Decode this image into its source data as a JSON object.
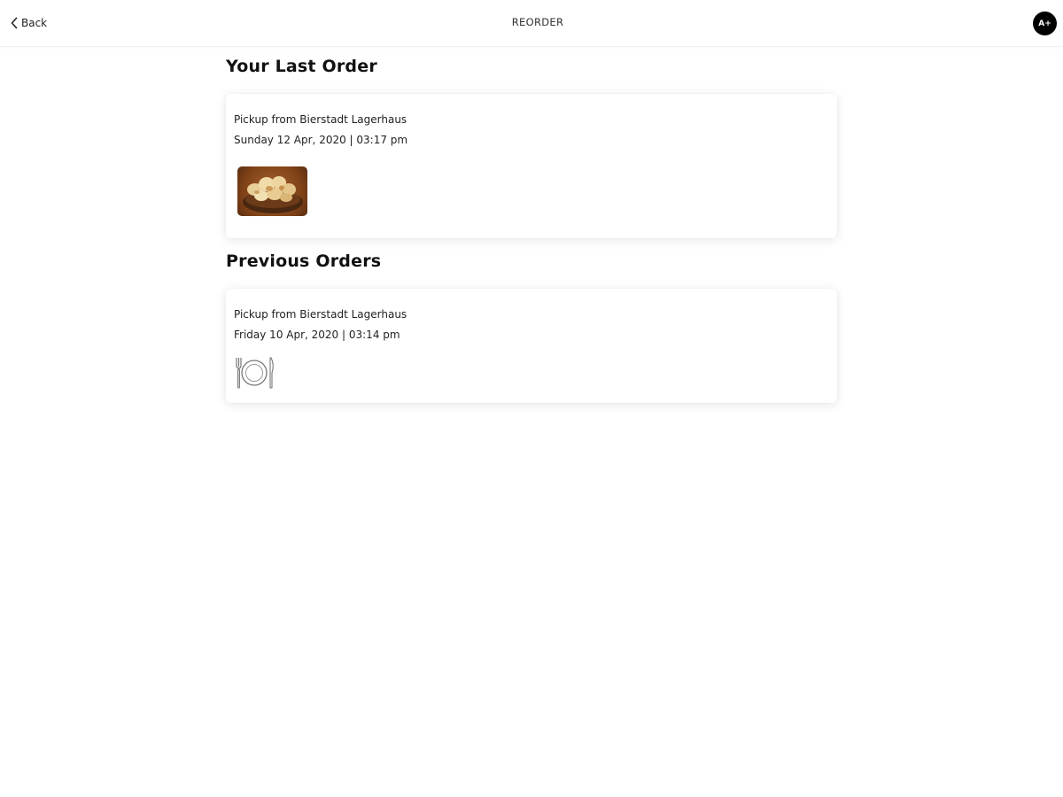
{
  "header": {
    "back_label": "Back",
    "title": "REORDER",
    "avatar_initials": "A+"
  },
  "last_order": {
    "heading": "Your Last Order",
    "pickup": "Pickup from Bierstadt Lagerhaus",
    "datetime": "Sunday 12 Apr, 2020 | 03:17 pm",
    "image_icon": "food-bread-basket-photo"
  },
  "previous_orders": {
    "heading": "Previous Orders",
    "items": [
      {
        "pickup": "Pickup from Bierstadt Lagerhaus",
        "datetime": "Friday 10 Apr, 2020 | 03:14 pm",
        "image_icon": "plate-fork-knife-icon"
      }
    ]
  },
  "colors": {
    "text": "#111111",
    "avatar_bg": "#000000",
    "card_bg": "#ffffff"
  }
}
